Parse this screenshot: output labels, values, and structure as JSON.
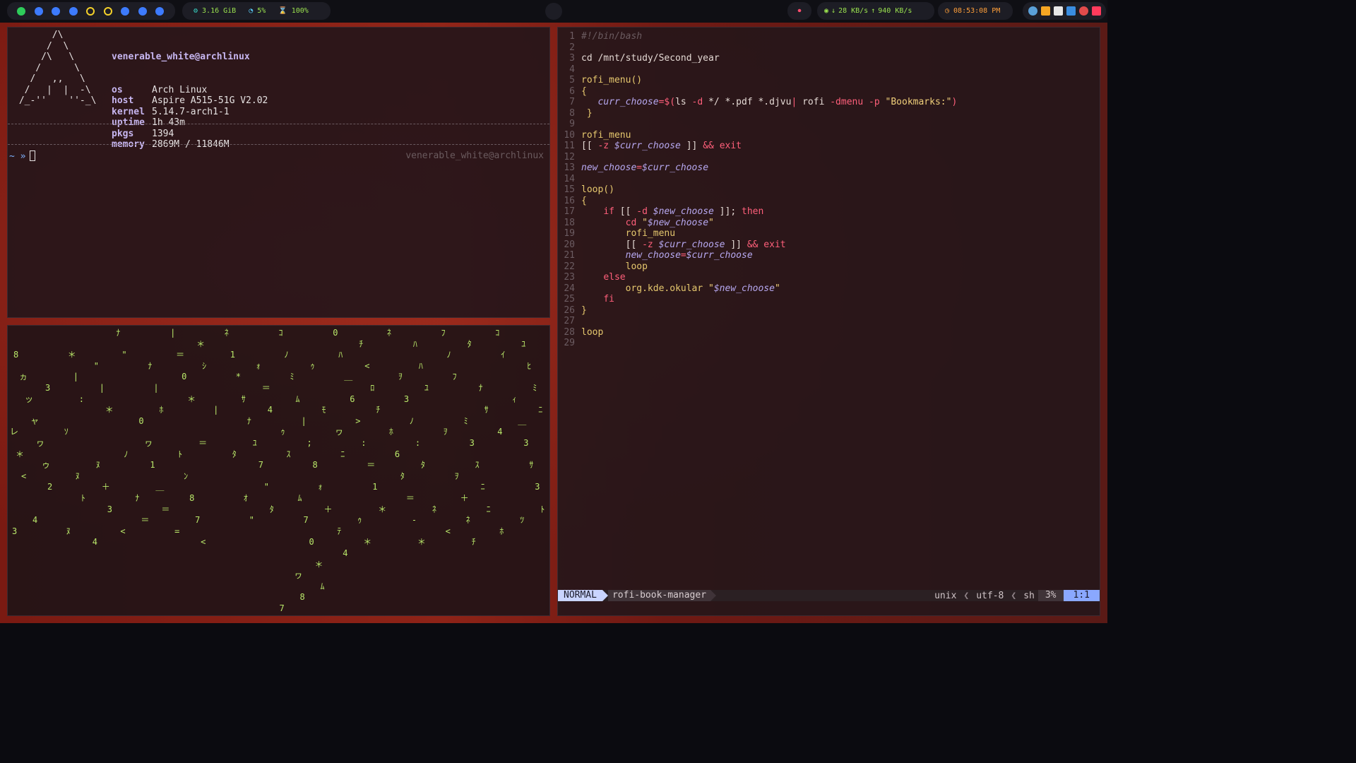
{
  "topbar": {
    "memory": "3.16 GiB",
    "cpu": "5%",
    "battery": "100%",
    "net_down": "28 KB/s",
    "net_up": "940 KB/s",
    "clock": "08:53:08 PM",
    "workspace_colors": [
      "#2ecc5a",
      "#3d7bff",
      "#3d7bff",
      "#3d7bff",
      "ring",
      "ring",
      "#3d7bff",
      "#3d7bff",
      "#3d7bff"
    ]
  },
  "neofetch": {
    "ascii": [
      "       /\\",
      "      /  \\",
      "     /\\   \\",
      "    /      \\",
      "   /   ,,   \\",
      "  /   |  |  -\\",
      " /_-''    ''-_\\"
    ],
    "user": "venerable_white@archlinux",
    "rows": [
      {
        "key": "os",
        "value": "Arch Linux"
      },
      {
        "key": "host",
        "value": "Aspire A515-51G V2.02"
      },
      {
        "key": "kernel",
        "value": "5.14.7-arch1-1"
      },
      {
        "key": "uptime",
        "value": "1h 43m"
      },
      {
        "key": "pkgs",
        "value": "1394"
      },
      {
        "key": "memory",
        "value": "2869M / 11846M"
      }
    ],
    "prompt": "~ »",
    "rprompt": "venerable_white@archlinux"
  },
  "matrix": {
    "columns": [
      "  8 ヵ3ッ ャレヮ＊ゥ<2  43",
      "  ＊\"||:＊ ｿ  ﾇﾇ＋ﾄ3 ﾇ4",
      "ﾅ \"ﾅ | ﾎ0 ヮﾉ1 ＿ﾅ＝＝<",
      "|＊＝ｼ0 ＊|  ＝ﾄ ﾝ 8 7=<",
      "ﾈ 1ｫ*＝ｻ4ﾅ ﾕﾀ7 \"ｵﾀ\"",
      "ｺ ﾉｩﾐ ﾑﾓ|ｩ;ｽ8 ｫﾑ＋7 0 ＊ヮﾑ87",
      "0ﾁﾊ<＿ﾛ6ﾁ>ヮ:ﾆ＝ 1 ＊ｩﾃ＊4",
      "ﾈﾊ ﾊｦﾕ3 ﾉﾎ:6ﾀﾀ ＝ﾈ- ＊",
      "ﾌﾀﾉ ﾌﾅ ｻﾐｦ3 ｽｦﾆ＋ﾆﾈ<ﾁ",
      "ｺﾕｲﾋ ﾐｨﾆ＿43 ｻ 3 ﾄﾂﾎ"
    ]
  },
  "editor": {
    "lines": [
      [
        [
          "comment",
          "#!/bin/bash"
        ]
      ],
      [],
      [
        [
          "plain",
          "cd /mnt/study/Second_year"
        ]
      ],
      [],
      [
        [
          "func",
          "rofi_menu()"
        ]
      ],
      [
        [
          "func",
          "{"
        ]
      ],
      [
        [
          "plain",
          "   "
        ],
        [
          "var",
          "curr_choose"
        ],
        [
          "kw",
          "=$("
        ],
        [
          "plain",
          "ls "
        ],
        [
          "kw",
          "-d"
        ],
        [
          "plain",
          " */ *.pdf *.djvu"
        ],
        [
          "kw",
          "|"
        ],
        [
          "plain",
          " rofi "
        ],
        [
          "kw",
          "-dmenu -p"
        ],
        [
          "plain",
          " "
        ],
        [
          "str",
          "\"Bookmarks:\""
        ],
        [
          "kw",
          ")"
        ]
      ],
      [
        [
          "func",
          " }"
        ]
      ],
      [],
      [
        [
          "func",
          "rofi_menu"
        ]
      ],
      [
        [
          "plain",
          "[[ "
        ],
        [
          "kw",
          "-z"
        ],
        [
          "plain",
          " "
        ],
        [
          "var",
          "$curr_choose"
        ],
        [
          "plain",
          " ]] "
        ],
        [
          "kw",
          "&&"
        ],
        [
          "plain",
          " "
        ],
        [
          "kw",
          "exit"
        ]
      ],
      [],
      [
        [
          "var",
          "new_choose"
        ],
        [
          "kw",
          "="
        ],
        [
          "var",
          "$curr_choose"
        ]
      ],
      [],
      [
        [
          "func",
          "loop()"
        ]
      ],
      [
        [
          "func",
          "{"
        ]
      ],
      [
        [
          "plain",
          "    "
        ],
        [
          "kw",
          "if"
        ],
        [
          "plain",
          " [[ "
        ],
        [
          "kw",
          "-d"
        ],
        [
          "plain",
          " "
        ],
        [
          "var",
          "$new_choose"
        ],
        [
          "plain",
          " ]]; "
        ],
        [
          "kw",
          "then"
        ]
      ],
      [
        [
          "plain",
          "        "
        ],
        [
          "kw",
          "cd"
        ],
        [
          "plain",
          " "
        ],
        [
          "str",
          "\""
        ],
        [
          "var",
          "$new_choose"
        ],
        [
          "str",
          "\""
        ]
      ],
      [
        [
          "plain",
          "        "
        ],
        [
          "func",
          "rofi_menu"
        ]
      ],
      [
        [
          "plain",
          "        [[ "
        ],
        [
          "kw",
          "-z"
        ],
        [
          "plain",
          " "
        ],
        [
          "var",
          "$curr_choose"
        ],
        [
          "plain",
          " ]] "
        ],
        [
          "kw",
          "&&"
        ],
        [
          "plain",
          " "
        ],
        [
          "kw",
          "exit"
        ]
      ],
      [
        [
          "plain",
          "        "
        ],
        [
          "var",
          "new_choose"
        ],
        [
          "kw",
          "="
        ],
        [
          "var",
          "$curr_choose"
        ]
      ],
      [
        [
          "plain",
          "        "
        ],
        [
          "func",
          "loop"
        ]
      ],
      [
        [
          "plain",
          "    "
        ],
        [
          "kw",
          "else"
        ]
      ],
      [
        [
          "plain",
          "        "
        ],
        [
          "func",
          "org.kde.okular"
        ],
        [
          "plain",
          " "
        ],
        [
          "str",
          "\""
        ],
        [
          "var",
          "$new_choose"
        ],
        [
          "str",
          "\""
        ]
      ],
      [
        [
          "plain",
          "    "
        ],
        [
          "kw",
          "fi"
        ]
      ],
      [
        [
          "func",
          "}"
        ]
      ],
      [],
      [
        [
          "func",
          "loop"
        ]
      ],
      []
    ],
    "status": {
      "mode": "NORMAL",
      "filename": "rofi-book-manager",
      "fileformat": "unix",
      "encoding": "utf-8",
      "filetype": "sh",
      "percent": "3%",
      "position": "1:1"
    }
  }
}
